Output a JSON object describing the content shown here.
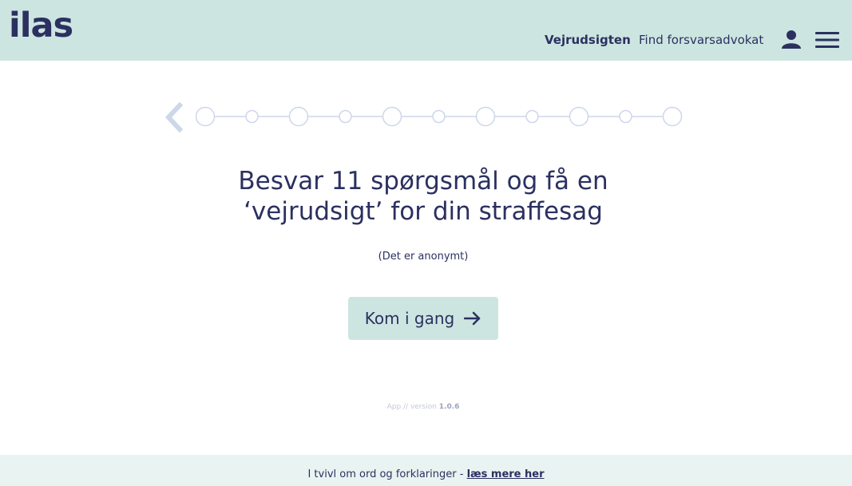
{
  "header": {
    "logo": "ilas",
    "nav": {
      "active": "Vejrudsigten",
      "link": "Find forsvarsadvokat"
    },
    "icons": [
      "user-icon",
      "menu-icon"
    ]
  },
  "stepper": {
    "total_steps": 11,
    "current_step": 0
  },
  "main": {
    "title_line1": "Besvar 11 spørgsmål og få en",
    "title_line2": "‘vejrudsigt’ for din straffesag",
    "subtitle": "(Det er anonymt)",
    "start_button": "Kom i gang"
  },
  "version": {
    "prefix": "App // version",
    "number": "1.0.6"
  },
  "footer": {
    "text": "I tvivl om ord og forklaringer -",
    "link": "læs mere her"
  },
  "colors": {
    "primary": "#2b3060",
    "header_bg": "#cde5e0",
    "footer_bg": "#e9f3f1",
    "step_border": "#cdd7ea"
  }
}
